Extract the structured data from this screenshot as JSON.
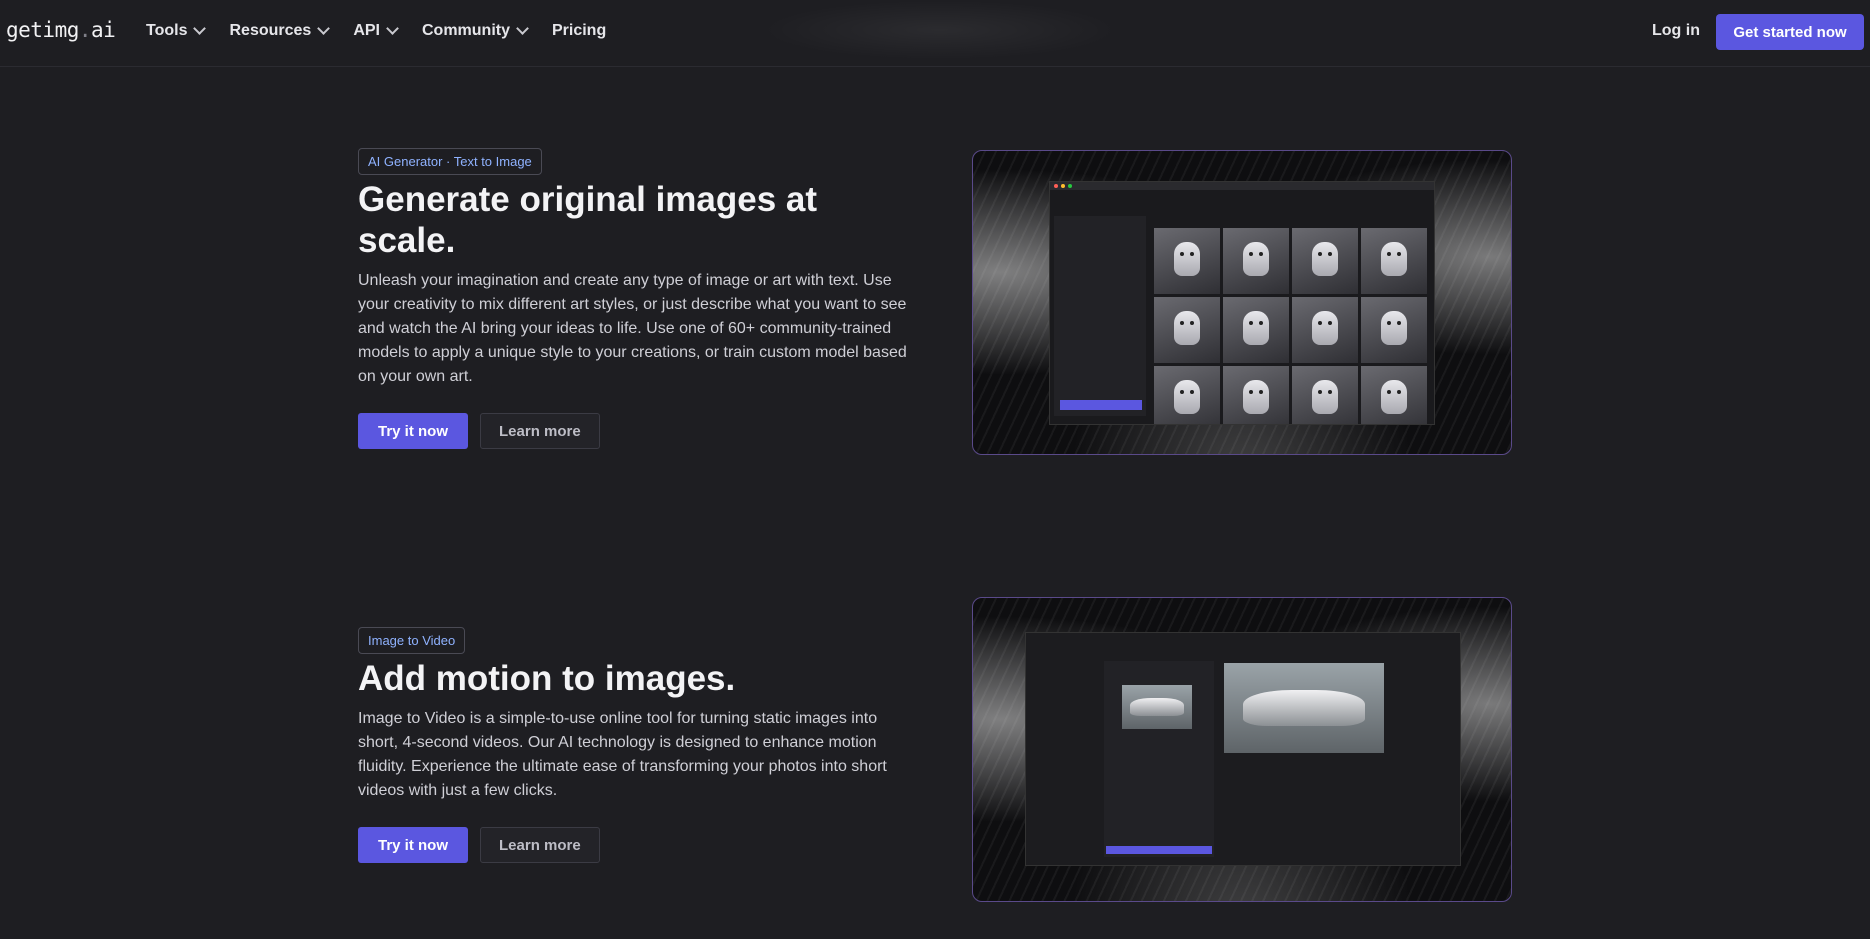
{
  "nav": {
    "logo_main": "getimg",
    "logo_dot": ".",
    "logo_suffix": "ai",
    "items": [
      {
        "label": "Tools"
      },
      {
        "label": "Resources"
      },
      {
        "label": "API"
      },
      {
        "label": "Community"
      },
      {
        "label": "Pricing"
      }
    ],
    "login": "Log in",
    "cta": "Get started now"
  },
  "sections": [
    {
      "badge": "AI Generator · Text to Image",
      "title": "Generate original images at scale.",
      "body": "Unleash your imagination and create any type of image or art with text. Use your creativity to mix different art styles, or just describe what you want to see and watch the AI bring your ideas to life. Use one of 60+ community-trained models to apply a unique style to your creations, or train custom model based on your own art.",
      "primary": "Try it now",
      "secondary": "Learn more"
    },
    {
      "badge": "Image to Video",
      "title": "Add motion to images.",
      "body": "Image to Video is a simple-to-use online tool for turning static images into short, 4-second videos. Our AI technology is designed to enhance motion fluidity. Experience the ultimate ease of transforming your photos into short videos with just a few clicks.",
      "primary": "Try it now",
      "secondary": "Learn more"
    }
  ],
  "colors": {
    "accent": "#5b57e0",
    "badge_text": "#8fb2ff",
    "background": "#1e1e22"
  }
}
